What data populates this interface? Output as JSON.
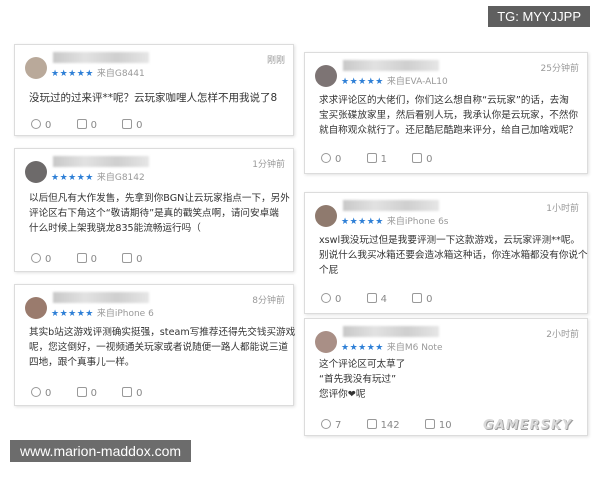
{
  "watermark_tg": "TG: MYYJJPP",
  "watermark_url": "www.marion-maddox.com",
  "watermark_logo": "GAMERSKY",
  "stars": "★★★★★",
  "comments": [
    {
      "source": "来自G8441",
      "time": "刚刚",
      "lines": [
        "没玩过的过来评**呢？云玩家咖哩人怎样不用我说了8"
      ],
      "counts": [
        "0",
        "0",
        "0"
      ]
    },
    {
      "source": "来自G8142",
      "time": "1分钟前",
      "lines": [
        "以后但凡有大作发售，先拿到你BGN让云玩家指点一下，另外",
        "评论区右下角这个“敬请期待”是真的戳笑点啊，请问安卓端",
        "什么时候上架我骁龙835能流畅运行吗（"
      ],
      "counts": [
        "0",
        "0",
        "0"
      ]
    },
    {
      "source": "来自iPhone 6",
      "time": "8分钟前",
      "lines": [
        "其实b站这游戏评测确实挺强，steam写推荐还得先交钱买游戏",
        "呢，您这倒好，一视频通关玩家或者说随便一路人都能说三道",
        "四地，跟个真事儿一样。"
      ],
      "counts": [
        "0",
        "0",
        "0"
      ]
    },
    {
      "source": "来自EVA-AL10",
      "time": "25分钟前",
      "lines": [
        "求求评论区的大佬们，你们这么想自称“云玩家”的话，去淘",
        "宝买张碟放家里，然后看别人玩，我承认你是云玩家，不然你",
        "就自称观众就行了。还尼酷尼酷跑来评分，给自己加啥戏呢？"
      ],
      "counts": [
        "0",
        "1",
        "0"
      ]
    },
    {
      "source": "来自iPhone 6s",
      "time": "1小时前",
      "lines": [
        "xswl我没玩过但是我要评测一下这款游戏，云玩家评测**呢。",
        "别说什么我买冰箱还要会造冰箱这种话，你连冰箱都没有你说个",
        "个屁"
      ],
      "counts": [
        "0",
        "4",
        "0"
      ]
    },
    {
      "source": "来自M6 Note",
      "time": "2小时前",
      "lines": [
        "这个评论区可太草了",
        "“首先我没有玩过”",
        "您评你❤呢"
      ],
      "counts": [
        "7",
        "142",
        "10"
      ]
    }
  ]
}
